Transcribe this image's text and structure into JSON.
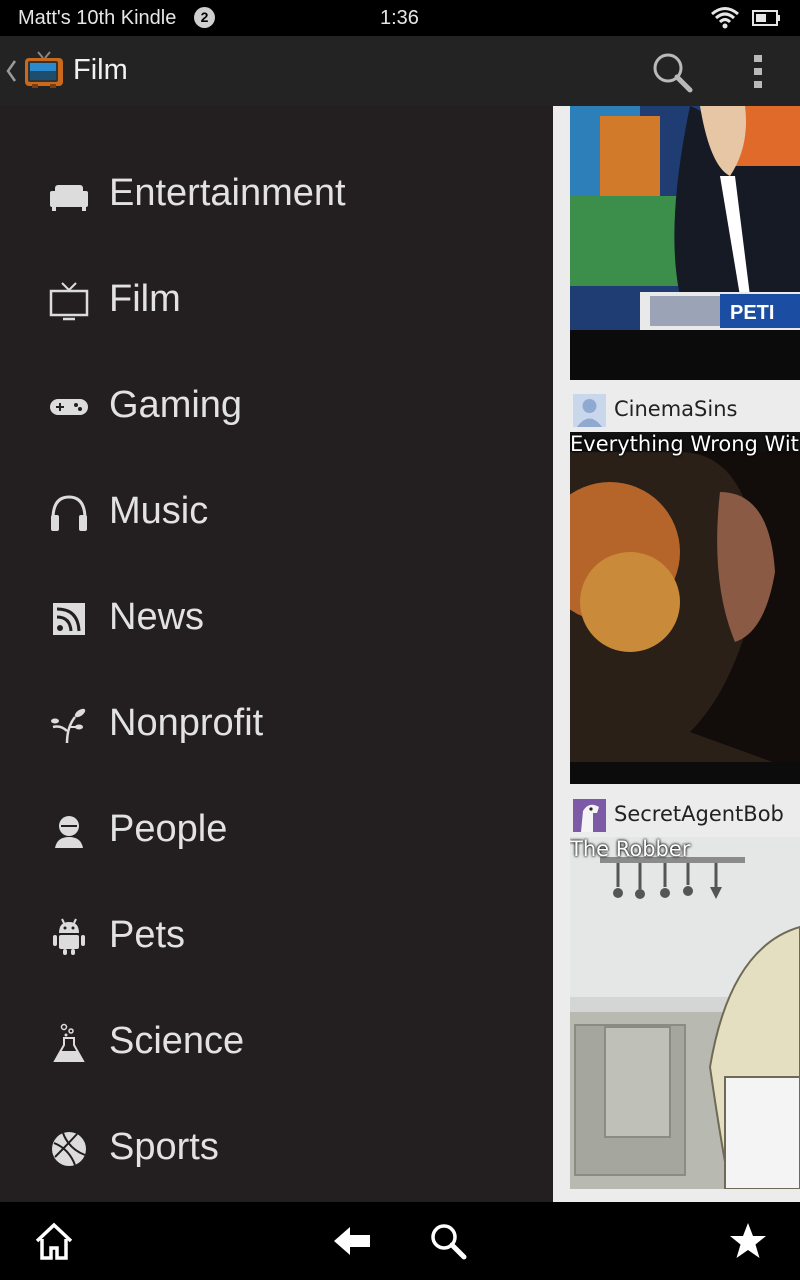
{
  "status_bar": {
    "device_name": "Matt's 10th Kindle",
    "notification_count": "2",
    "time": "1:36",
    "icons": [
      "wifi-icon",
      "battery-icon"
    ]
  },
  "action_bar": {
    "title": "Film",
    "icons": [
      "up-caret-icon",
      "tv-app-icon",
      "search-icon",
      "overflow-menu-icon"
    ]
  },
  "drawer": {
    "items": [
      {
        "label": "Entertainment",
        "icon": "couch-icon"
      },
      {
        "label": "Film",
        "icon": "tv-icon"
      },
      {
        "label": "Gaming",
        "icon": "gamepad-icon"
      },
      {
        "label": "Music",
        "icon": "headphones-icon"
      },
      {
        "label": "News",
        "icon": "rss-icon"
      },
      {
        "label": "Nonprofit",
        "icon": "sprout-icon"
      },
      {
        "label": "People",
        "icon": "person-icon"
      },
      {
        "label": "Pets",
        "icon": "android-icon"
      },
      {
        "label": "Science",
        "icon": "flask-icon"
      },
      {
        "label": "Sports",
        "icon": "basketball-icon"
      }
    ]
  },
  "feed": {
    "items": [
      {
        "owner": "CinemaSins",
        "title": "Everything Wrong Wit"
      },
      {
        "owner": "SecretAgentBob",
        "title": "The Robber"
      }
    ]
  },
  "bottom_nav": {
    "icons": [
      "home-icon",
      "back-icon",
      "search-icon",
      "favorites-star-icon"
    ]
  },
  "colors": {
    "drawer_bg": "#231f20",
    "action_bar_bg": "#232323",
    "feed_bg": "#ececec",
    "drawer_text": "#e2e2e2"
  }
}
